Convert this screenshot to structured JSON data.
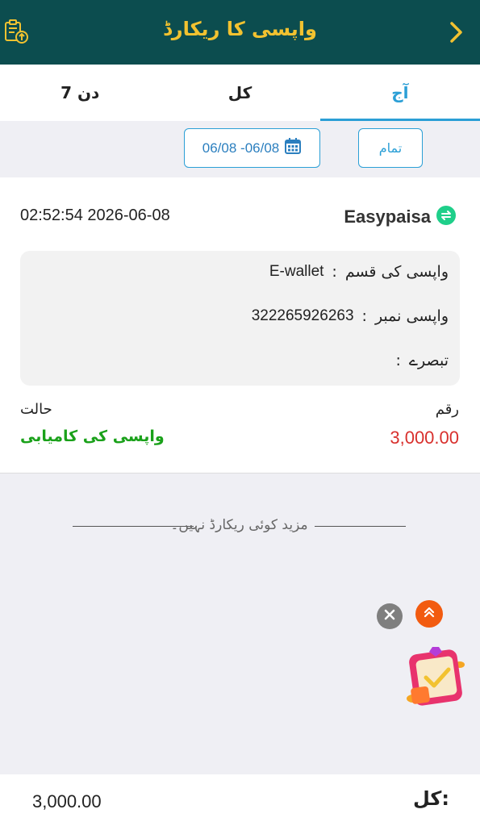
{
  "header": {
    "title": "واپسی کا ریکارڈ"
  },
  "tabs": [
    {
      "label": "آج",
      "active": true
    },
    {
      "label": "کل",
      "active": false
    },
    {
      "label": "7 دن",
      "active": false
    }
  ],
  "filters": {
    "date_range": "06/08 -06/08",
    "all_label": "تمام"
  },
  "record": {
    "datetime": "02:52:54 2026-06-08",
    "brand": "Easypaisa",
    "rows": [
      {
        "label": "واپسی کی قسم",
        "value": "E-wallet"
      },
      {
        "label": "واپسی نمبر",
        "value": "322265926263"
      },
      {
        "label": "تبصرے",
        "value": ""
      }
    ],
    "separator": ":",
    "amount_label": "رقم",
    "amount": "3,000.00",
    "status_label": "حالت",
    "status": "واپسی کی کامیابی"
  },
  "no_more": "مزید کوئی ریکارڈ نہیں۔",
  "footer": {
    "total_label": "کل:",
    "total_value": "3,000.00"
  },
  "colors": {
    "header_bg": "#0c4d4f",
    "title": "#f2c230",
    "accent": "#2b9fd6",
    "amount": "#d8302d",
    "success": "#1aa11a"
  }
}
